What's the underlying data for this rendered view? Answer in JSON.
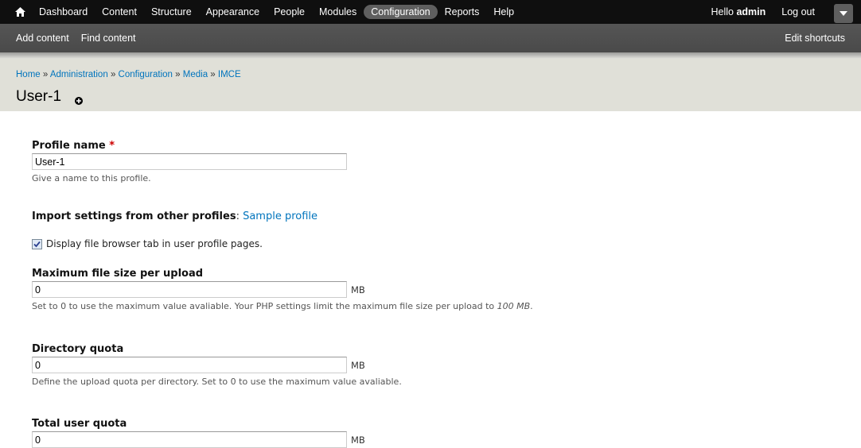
{
  "toolbar": {
    "nav": [
      "Dashboard",
      "Content",
      "Structure",
      "Appearance",
      "People",
      "Modules",
      "Configuration",
      "Reports",
      "Help"
    ],
    "active": "Configuration",
    "hello_prefix": "Hello ",
    "username": "admin",
    "logout": "Log out"
  },
  "shortcuts": {
    "items": [
      "Add content",
      "Find content"
    ],
    "edit": "Edit shortcuts"
  },
  "breadcrumb": {
    "items": [
      "Home",
      "Administration",
      "Configuration",
      "Media",
      "IMCE"
    ],
    "separator": "»"
  },
  "page": {
    "title": "User-1"
  },
  "form": {
    "profile_name": {
      "label": "Profile name",
      "required_mark": "*",
      "value": "User-1",
      "description": "Give a name to this profile."
    },
    "import": {
      "label": "Import settings from other profiles",
      "colon": ":",
      "link": "Sample profile"
    },
    "usertab": {
      "label": "Display file browser tab in user profile pages.",
      "checked": true
    },
    "filesize": {
      "label": "Maximum file size per upload",
      "value": "0",
      "unit": "MB",
      "description_prefix": "Set to 0 to use the maximum value avaliable. Your PHP settings limit the maximum file size per upload to ",
      "description_limit": "100 MB",
      "description_suffix": "."
    },
    "quota": {
      "label": "Directory quota",
      "value": "0",
      "unit": "MB",
      "description": "Define the upload quota per directory. Set to 0 to use the maximum value avaliable."
    },
    "tuquota": {
      "label": "Total user quota",
      "value": "0",
      "unit": "MB"
    }
  }
}
